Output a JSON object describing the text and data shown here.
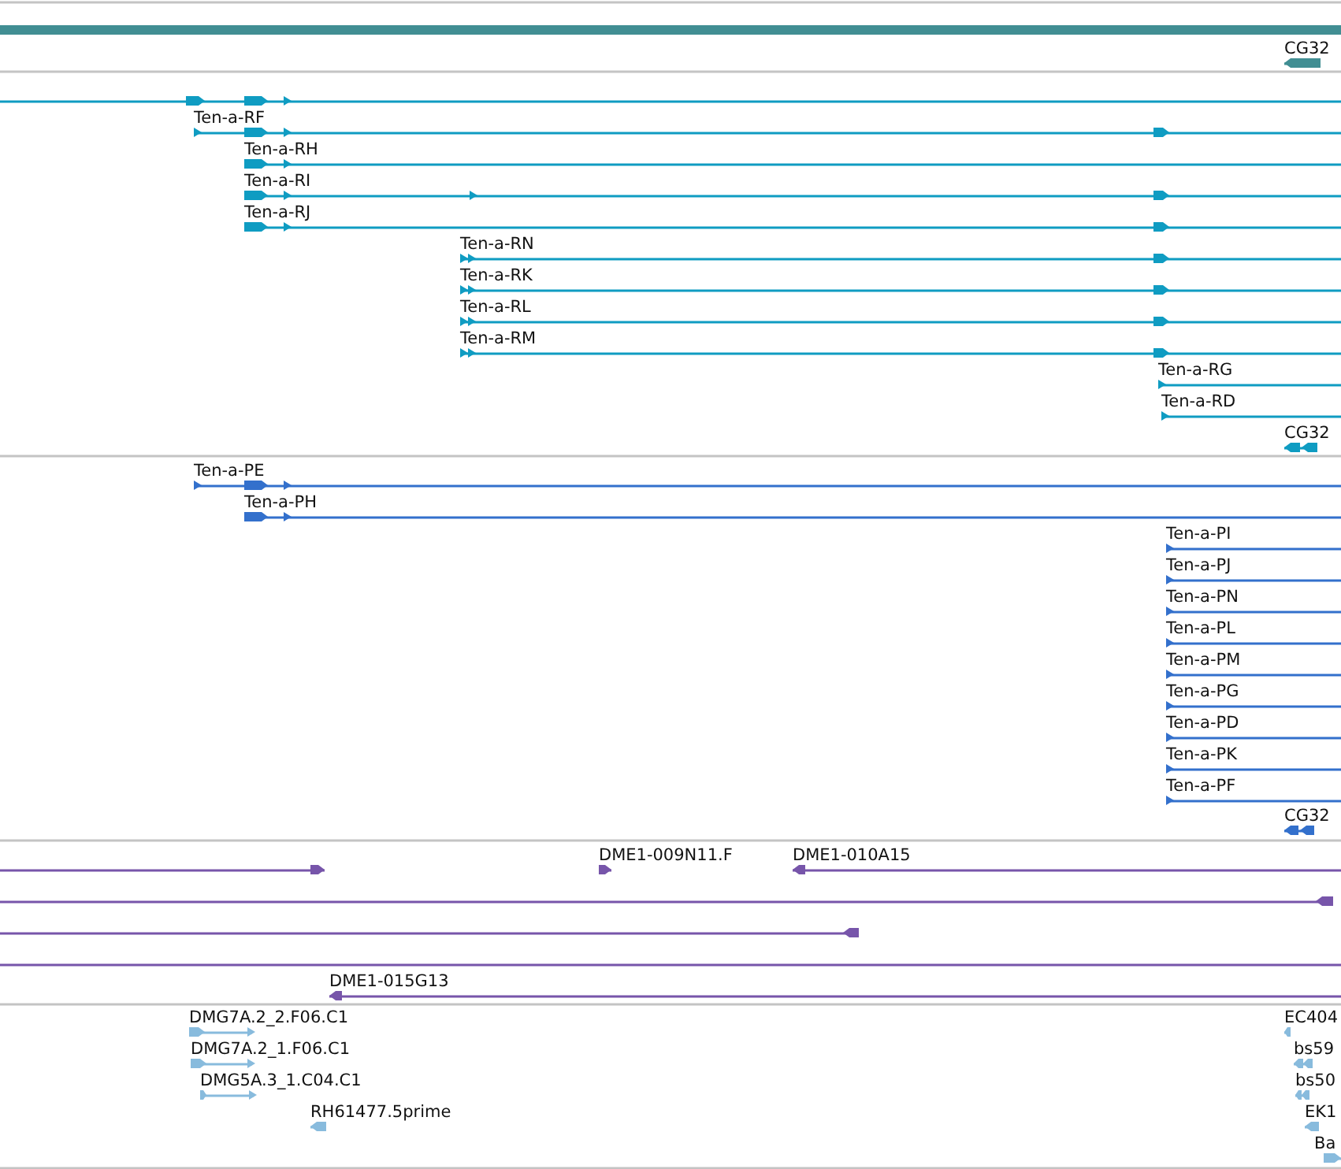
{
  "overview_bar": {
    "color": "#418e93"
  },
  "tracks": [
    {
      "color": "#418e93",
      "features": [
        {
          "label": "CG32",
          "reverse": true
        }
      ]
    },
    {
      "color": "#0f9cc2",
      "features": [
        {
          "reverse": false
        },
        {
          "label": "Ten-a-RF",
          "reverse": false
        },
        {
          "label": "Ten-a-RH",
          "reverse": false
        },
        {
          "label": "Ten-a-RI",
          "reverse": false
        },
        {
          "label": "Ten-a-RJ",
          "reverse": false
        },
        {
          "label": "Ten-a-RN",
          "reverse": false
        },
        {
          "label": "Ten-a-RK",
          "reverse": false
        },
        {
          "label": "Ten-a-RL",
          "reverse": false
        },
        {
          "label": "Ten-a-RM",
          "reverse": false
        },
        {
          "label": "Ten-a-RG",
          "reverse": false
        },
        {
          "label": "Ten-a-RD",
          "reverse": false
        },
        {
          "label": "CG32",
          "reverse": true
        }
      ]
    },
    {
      "color": "#3370cc",
      "features": [
        {
          "label": "Ten-a-PE",
          "reverse": false
        },
        {
          "label": "Ten-a-PH",
          "reverse": false
        },
        {
          "label": "Ten-a-PI",
          "reverse": false
        },
        {
          "label": "Ten-a-PJ",
          "reverse": false
        },
        {
          "label": "Ten-a-PN",
          "reverse": false
        },
        {
          "label": "Ten-a-PL",
          "reverse": false
        },
        {
          "label": "Ten-a-PM",
          "reverse": false
        },
        {
          "label": "Ten-a-PG",
          "reverse": false
        },
        {
          "label": "Ten-a-PD",
          "reverse": false
        },
        {
          "label": "Ten-a-PK",
          "reverse": false
        },
        {
          "label": "Ten-a-PF",
          "reverse": false
        },
        {
          "label": "CG32",
          "reverse": true
        }
      ]
    },
    {
      "color": "#7755aa",
      "features": [
        {
          "reverse": false
        },
        {
          "label": "DME1-009N11.F",
          "reverse": false
        },
        {
          "label": "DME1-010A15",
          "reverse": true
        },
        {
          "reverse": true
        },
        {
          "reverse": true
        },
        {
          "kind": "span"
        },
        {
          "label": "DME1-015G13",
          "reverse": true
        }
      ]
    },
    {
      "color": "#88bbdd",
      "features": [
        {
          "label": "DMG7A.2_2.F06.C1",
          "reverse": false
        },
        {
          "label": "DMG7A.2_1.F06.C1",
          "reverse": false
        },
        {
          "label": "DMG5A.3_1.C04.C1",
          "reverse": false
        },
        {
          "label": "RH61477.5prime",
          "reverse": true
        },
        {
          "label": "EC404",
          "reverse": true
        },
        {
          "label": "bs59",
          "reverse": true
        },
        {
          "label": "bs50",
          "reverse": true
        },
        {
          "label": "EK1",
          "reverse": true
        },
        {
          "label": "Ba",
          "reverse": false
        }
      ]
    }
  ]
}
